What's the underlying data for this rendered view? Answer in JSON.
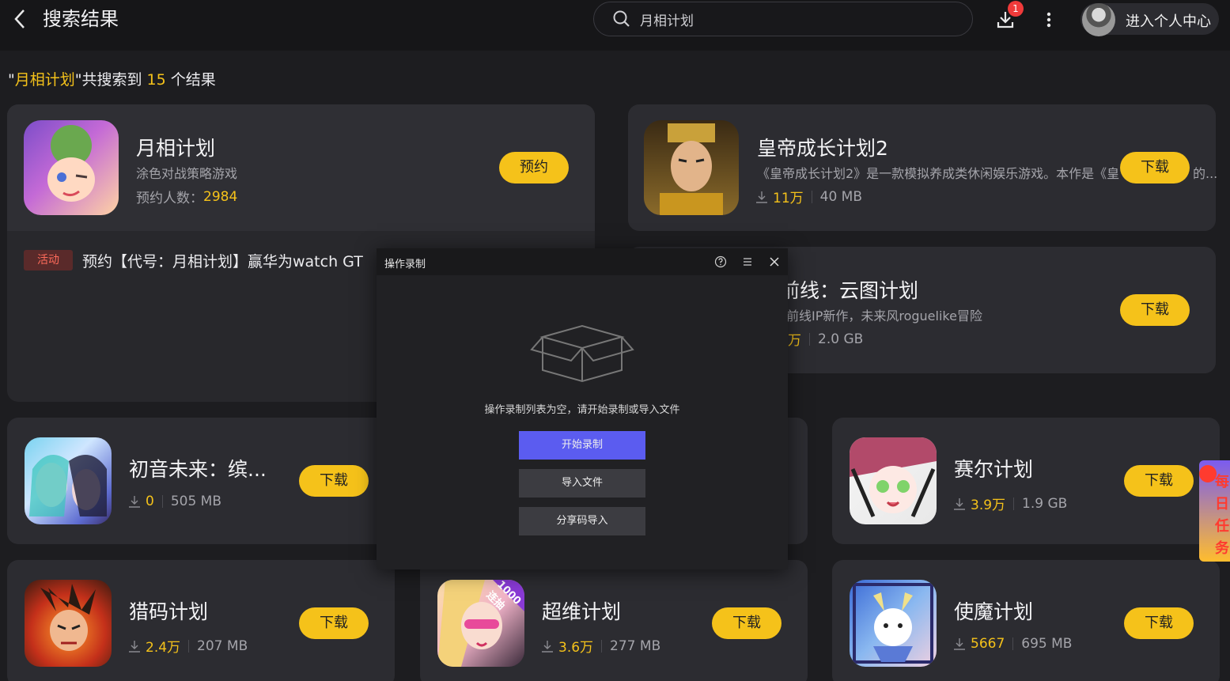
{
  "header": {
    "page_title": "搜索结果",
    "search_value": "月相计划",
    "download_badge": "1",
    "user_center": "进入个人中心"
  },
  "result_summary": {
    "prefix": "\"",
    "keyword": "月相计划",
    "middle": "\"共搜索到 ",
    "count": "15",
    "suffix": " 个结果"
  },
  "featured": {
    "name": "月相计划",
    "subtitle": "涂色对战策略游戏",
    "reserve_label": "预约人数：",
    "reserve_count": "2984",
    "button": "预约",
    "activity_tag": "活动",
    "activity_text": "预约【代号：月相计划】赢华为watch GT"
  },
  "results": [
    {
      "name": "皇帝成长计划2",
      "desc": "《皇帝成长计划2》是一款模拟养成类休闲娱乐游戏。本作是《皇",
      "desc_tail": "的...",
      "downloads": "11万",
      "size": "40 MB",
      "button": "下载"
    },
    {
      "name": "前线：云图计划",
      "desc": "前线IP新作，未来风roguelike冒险",
      "downloads": "万",
      "size": "2.0 GB",
      "button": "下载"
    },
    {
      "name": "初音未来：缤...",
      "downloads": "0",
      "size": "505 MB",
      "button": "下载"
    },
    {
      "name": "赛尔计划",
      "downloads": "3.9万",
      "size": "1.9 GB",
      "button": "下载"
    },
    {
      "name": "猎码计划",
      "downloads": "2.4万",
      "size": "207 MB",
      "button": "下载"
    },
    {
      "name": "超维计划",
      "downloads": "3.6万",
      "size": "277 MB",
      "button": "下载",
      "icon_badge": "1000连抽"
    },
    {
      "name": "使魔计划",
      "downloads": "5667",
      "size": "695 MB",
      "button": "下载"
    }
  ],
  "dialog": {
    "title": "操作录制",
    "empty_message": "操作录制列表为空，请开始录制或导入文件",
    "start_button": "开始录制",
    "import_button": "导入文件",
    "share_button": "分享码导入"
  },
  "promo": {
    "text": "每日任务"
  },
  "colors": {
    "accent": "#f5c21a",
    "primary_button": "#5b5cf0",
    "badge": "#f03a3a"
  }
}
